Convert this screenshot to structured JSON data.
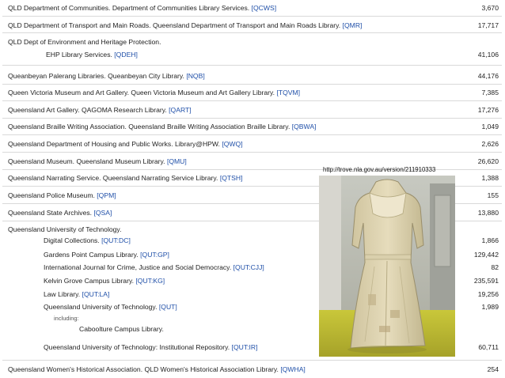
{
  "rows": [
    {
      "name": "QLD Department of Communities. Department of Communities Library Services.",
      "code": "[QCWS]",
      "count": "3,670"
    },
    {
      "name": "QLD Department of Transport and Main Roads. Queensland Department of Transport and Main Roads Library.",
      "code": "[QMR]",
      "count": "17,717"
    },
    {
      "name": "QLD Dept of Environment and Heritage Protection.",
      "sub_name": "EHP Library Services.",
      "code": "[QDEH]",
      "count": "41,106"
    },
    {
      "name": "Queanbeyan Palerang Libraries. Queanbeyan City Library.",
      "code": "[NQB]",
      "count": "44,176"
    },
    {
      "name": "Queen Victoria Museum and Art Gallery. Queen Victoria Museum and Art Gallery Library.",
      "code": "[TQVM]",
      "count": "7,385"
    },
    {
      "name": "Queensland Art Gallery. QAGOMA Research Library.",
      "code": "[QART]",
      "count": "17,276"
    },
    {
      "name": "Queensland Braille Writing Association. Queensland Braille Writing Association Braille Library.",
      "code": "[QBWA]",
      "count": "1,049"
    },
    {
      "name": "Queensland Department of Housing and Public Works. Library@HPW.",
      "code": "[QWQ]",
      "count": "2,626"
    },
    {
      "name": "Queensland Museum. Queensland Museum Library.",
      "code": "[QMU]",
      "count": "26,620"
    },
    {
      "name": "Queensland Narrating Service. Queensland Narrating Service Library.",
      "code": "[QTSH]",
      "count": "1,388"
    },
    {
      "name": "Queensland Police Museum.",
      "code": "[QPM]",
      "count": "155"
    },
    {
      "name": "Queensland State Archives.",
      "code": "[QSA]",
      "count": "13,880"
    }
  ],
  "qut": {
    "name": "Queensland University of Technology.",
    "items": [
      {
        "name": "Digital Collections.",
        "code": "[QUT:DC]",
        "count": "1,866"
      },
      {
        "name": "Gardens Point Campus Library.",
        "code": "[QUT:GP]",
        "count": "129,442"
      },
      {
        "name": "International Journal for Crime, Justice and Social Democracy.",
        "code": "[QUT:CJJ]",
        "count": "82"
      },
      {
        "name": "Kelvin Grove Campus Library.",
        "code": "[QUT:KG]",
        "count": "235,591"
      },
      {
        "name": "Law Library.",
        "code": "[QUT:LA]",
        "count": "19,256"
      },
      {
        "name": "Queensland University of Technology.",
        "code": "[QUT]",
        "count": "1,989"
      }
    ],
    "including_label": "including:",
    "including_item": "Caboolture Campus Library.",
    "repo": {
      "name": "Queensland University of Technology: Institutional Repository.",
      "code": "[QUT:IR]",
      "count": "60,711"
    }
  },
  "last_row": {
    "name": "Queensland Women's Historical Association. QLD Women's Historical Association Library.",
    "code": "[QWHA]",
    "count": "254"
  },
  "photo": {
    "url": "http://trove.nla.gov.au/version/211910333"
  },
  "colors": {
    "link": "#1f4fa8",
    "border": "#d9d9d9"
  }
}
